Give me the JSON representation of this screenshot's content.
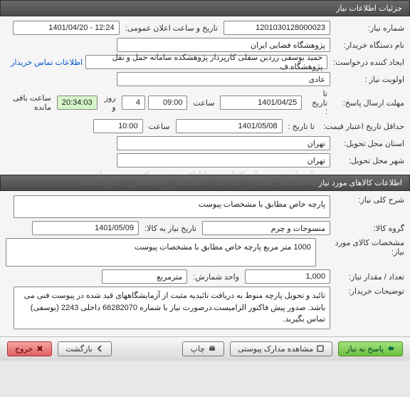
{
  "headers": {
    "need_details": "جزئیات اطلاعات نیاز",
    "goods_info": "اطلاعات کالاهای مورد نیاز"
  },
  "labels": {
    "need_number": "شماره نیاز:",
    "public_announce_datetime": "تاریخ و ساعت اعلان عمومی:",
    "buyer_org": "نام دستگاه خریدار:",
    "request_creator": "ایجاد کننده درخواست:",
    "buyer_contact": "اطلاعات تماس خریدار",
    "priority": "اولویت نیاز :",
    "reply_deadline": "مهلت ارسال پاسخ:",
    "to_date": "تا تاریخ :",
    "hour": "ساعت",
    "days_and": "روز و",
    "remaining": "ساعت باقی مانده",
    "price_validity_min": "حداقل تاریخ اعتبار قیمت:",
    "delivery_province": "استان محل تحویل:",
    "delivery_city": "شهر محل تحویل:",
    "need_summary": "شرح کلی نیاز:",
    "goods_group": "گروه کالا:",
    "need_goods_date": "تاریخ نیاز به کالا:",
    "goods_specs": "مشخصات کالای مورد نیاز:",
    "qty": "تعداد / مقدار نیاز:",
    "unit": "واحد شمارش:",
    "buyer_notes": "توضیحات خریدار:"
  },
  "values": {
    "need_number": "1201030128000023",
    "public_announce_datetime": "1401/04/20 - 12:24",
    "buyer_org": "پژوهشگاه فضایی ایران",
    "request_creator": "حمید یوسفی زردین سفلی کارپرداز پژوهشکده سامانه حمل و نقل پژوهشگاه ف",
    "priority": "عادی",
    "reply_to_date": "1401/04/25",
    "reply_hour": "09:00",
    "days_left": "4",
    "time_left": "20:34:03",
    "price_to_date": "1401/05/08",
    "price_hour": "10:00",
    "delivery_province": "تهران",
    "delivery_city": "تهران",
    "need_summary": "پارچه خاص مطابق با مشخصات پیوست",
    "goods_group": "منسوجات و چرم",
    "need_goods_date": "1401/05/09",
    "goods_specs": "1000 متر مربع پارچه خاص مطابق با مشخصات پیوست",
    "qty": "1,000",
    "unit": "مترمربع",
    "buyer_notes": "تائید و تحویل پارچه منوط به دریافت تائیدیه مثبت از آزمایشگاههای قید شده در پیوست فنی می باشد. صدور پیش فاکتور الزامیست.درصورت نیاز با شماره 66282070 داخلی 2243 (یوسفی) تماس بگیرید."
  },
  "buttons": {
    "reply": "پاسخ به نیاز",
    "view_attachments": "مشاهده مدارک پیوستی",
    "print": "چاپ",
    "back": "بازگشت",
    "exit": "خروج"
  },
  "watermark": "سامانه تدارکات الکترونیکی دولت"
}
